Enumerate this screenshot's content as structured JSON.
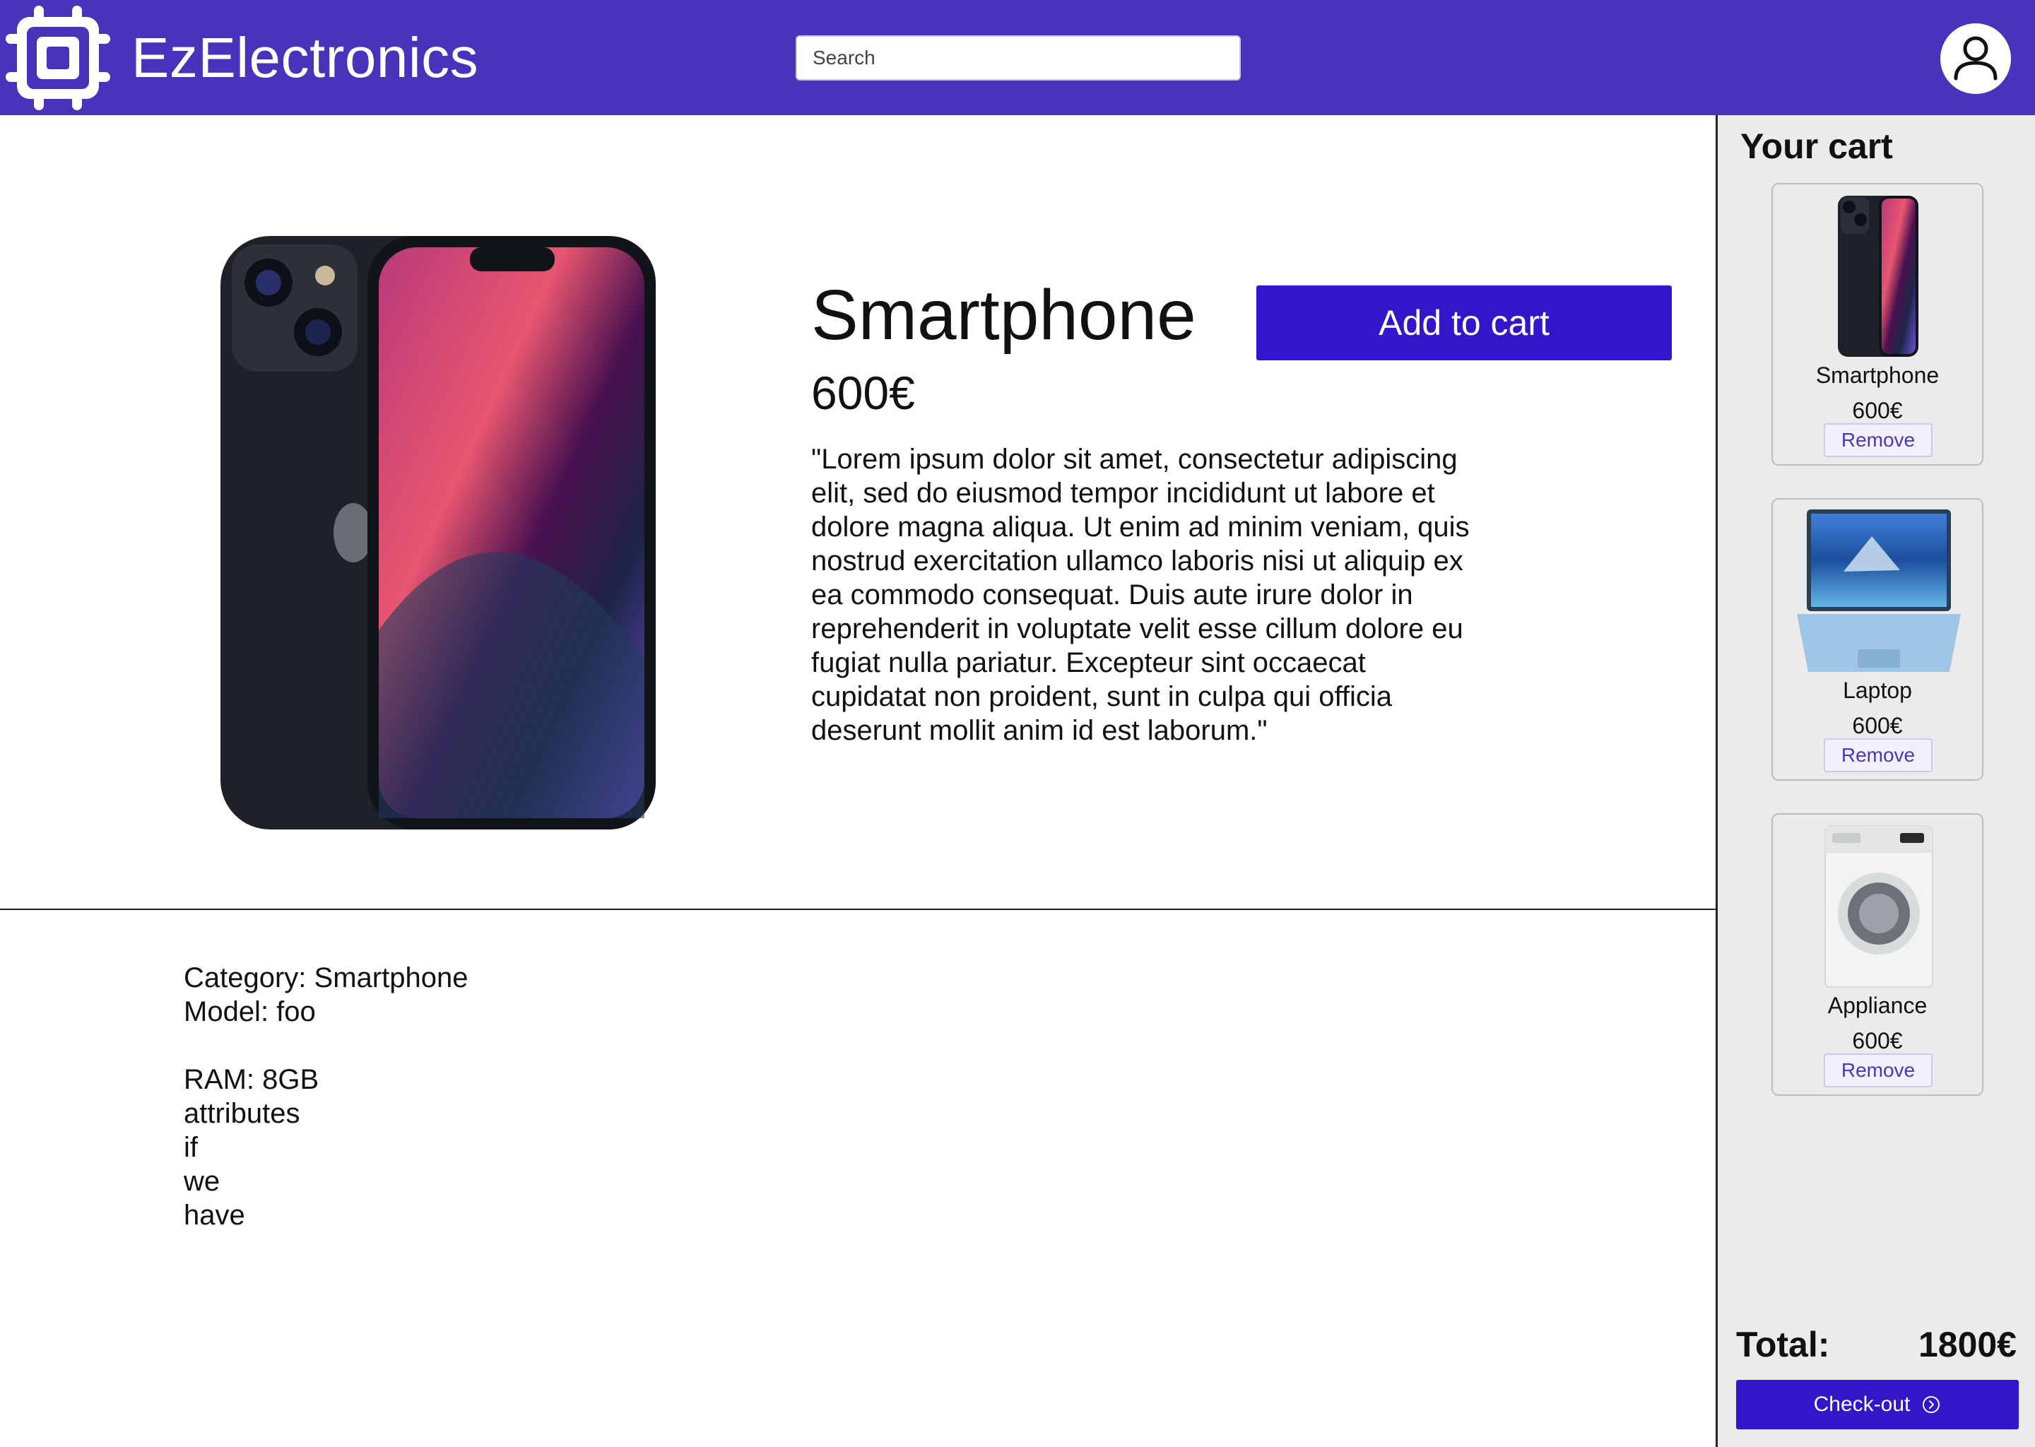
{
  "header": {
    "brand": "EzElectronics",
    "search_placeholder": "Search"
  },
  "product": {
    "title": "Smartphone",
    "price": "600€",
    "add_to_cart_label": "Add to cart",
    "description": "\"Lorem ipsum dolor sit amet, consectetur adipiscing elit, sed do eiusmod tempor incididunt ut labore et dolore magna aliqua. Ut enim ad minim veniam, quis nostrud exercitation ullamco laboris nisi ut aliquip ex ea commodo consequat. Duis aute irure dolor in reprehenderit in voluptate velit esse cillum dolore eu fugiat nulla pariatur. Excepteur sint occaecat cupidatat non proident, sunt in culpa qui officia deserunt mollit anim id est laborum.\"",
    "details": {
      "category": "Category: Smartphone",
      "model": "Model: foo",
      "lines": [
        "RAM: 8GB",
        "attributes",
        "if",
        "we",
        "have"
      ]
    }
  },
  "cart": {
    "title": "Your cart",
    "items": [
      {
        "name": "Smartphone",
        "price": "600€",
        "remove_label": "Remove",
        "icon": "smartphone-image"
      },
      {
        "name": "Laptop",
        "price": "600€",
        "remove_label": "Remove",
        "icon": "laptop-image"
      },
      {
        "name": "Appliance",
        "price": "600€",
        "remove_label": "Remove",
        "icon": "washing-machine-image"
      }
    ],
    "total_label": "Total:",
    "total_value": "1800€",
    "checkout_label": "Check-out"
  },
  "colors": {
    "header": "#4833bb",
    "primary_button": "#3117c9",
    "sidebar": "#ebebeb"
  }
}
